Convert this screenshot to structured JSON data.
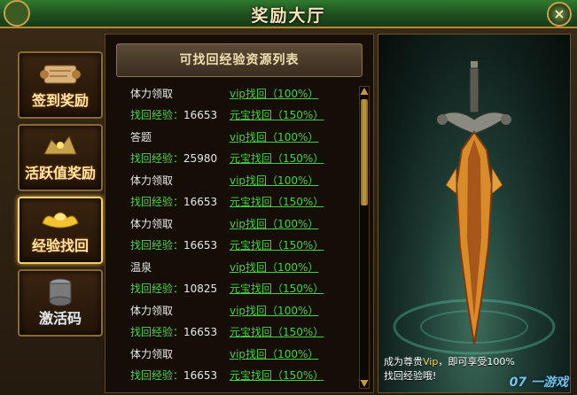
{
  "window": {
    "title": "奖励大厅",
    "close_label": "×"
  },
  "sidebar": {
    "items": [
      {
        "label": "签到奖励",
        "icon": "scroll-icon",
        "active": false
      },
      {
        "label": "活跃值奖励",
        "icon": "treasure-icon",
        "active": false
      },
      {
        "label": "经验找回",
        "icon": "gold-ingot-icon",
        "active": true
      },
      {
        "label": "激活码",
        "icon": "stone-drum-icon",
        "active": false
      }
    ]
  },
  "list": {
    "header": "可找回经验资源列表",
    "exp_prefix": "找回经验：",
    "rows": [
      {
        "name": "体力领取",
        "exp": "16653",
        "vip": "vip找回（100%）",
        "yuanbao": "元宝找回（150%）"
      },
      {
        "name": "答题",
        "exp": "25980",
        "vip": "vip找回（100%）",
        "yuanbao": "元宝找回（150%）"
      },
      {
        "name": "体力领取",
        "exp": "16653",
        "vip": "vip找回（100%）",
        "yuanbao": "元宝找回（150%）"
      },
      {
        "name": "体力领取",
        "exp": "16653",
        "vip": "vip找回（100%）",
        "yuanbao": "元宝找回（150%）"
      },
      {
        "name": "温泉",
        "exp": "10825",
        "vip": "vip找回（100%）",
        "yuanbao": "元宝找回（150%）"
      },
      {
        "name": "体力领取",
        "exp": "16653",
        "vip": "vip找回（100%）",
        "yuanbao": "元宝找回（150%）"
      },
      {
        "name": "体力领取",
        "exp": "16653",
        "vip": "vip找回（100%）",
        "yuanbao": "元宝找回（150%）"
      }
    ]
  },
  "art": {
    "caption_line1_a": "成为尊贵",
    "caption_line1_vip": "Vip",
    "caption_line1_b": "，即可享受100%",
    "caption_line2": "找回经验哦!",
    "watermark": "07 一游戏"
  },
  "colors": {
    "accent_gold": "#f0d070",
    "link_green": "#45d045",
    "title_green": "#2f7a2f"
  }
}
